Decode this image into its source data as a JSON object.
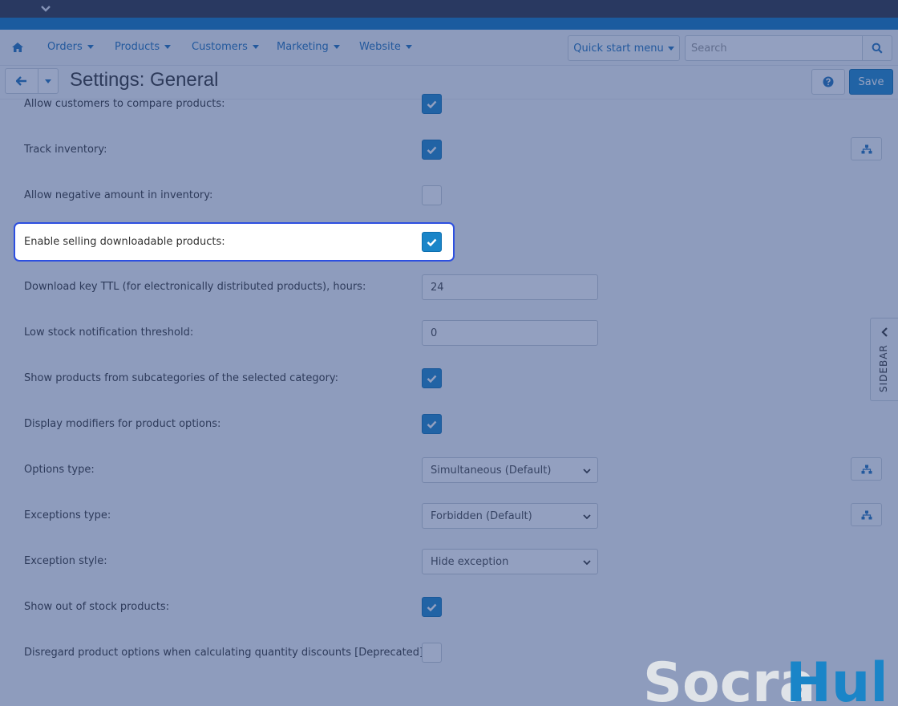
{
  "nav": {
    "items": [
      {
        "label": "Orders"
      },
      {
        "label": "Products"
      },
      {
        "label": "Customers"
      },
      {
        "label": "Marketing"
      },
      {
        "label": "Website"
      }
    ],
    "quick_start": "Quick start menu",
    "search_placeholder": "Search"
  },
  "header": {
    "title": "Settings: General",
    "save_label": "Save"
  },
  "settings": [
    {
      "label": "Allow customers to compare products:",
      "control": "checkbox",
      "checked": true
    },
    {
      "label": "Track inventory:",
      "control": "checkbox",
      "checked": true
    },
    {
      "label": "Allow negative amount in inventory:",
      "control": "checkbox",
      "checked": false
    },
    {
      "label": "Enable selling downloadable products:",
      "control": "checkbox",
      "checked": true,
      "highlighted": true
    },
    {
      "label": "Download key TTL (for electronically distributed products), hours:",
      "control": "text",
      "value": "24"
    },
    {
      "label": "Low stock notification threshold:",
      "control": "text",
      "value": "0"
    },
    {
      "label": "Show products from subcategories of the selected category:",
      "control": "checkbox",
      "checked": true
    },
    {
      "label": "Display modifiers for product options:",
      "control": "checkbox",
      "checked": true
    },
    {
      "label": "Options type:",
      "control": "select",
      "value": "Simultaneous (Default)"
    },
    {
      "label": "Exceptions type:",
      "control": "select",
      "value": "Forbidden (Default)"
    },
    {
      "label": "Exception style:",
      "control": "select",
      "value": "Hide exception"
    },
    {
      "label": "Show out of stock products:",
      "control": "checkbox",
      "checked": true
    },
    {
      "label": "Disregard product options when calculating quantity discounts [Deprecated]:",
      "control": "checkbox",
      "checked": false
    }
  ],
  "sidebar": {
    "label": "SIDEBAR"
  },
  "watermark": {
    "text_a": "Socra",
    "text_b": "Hub"
  },
  "colors": {
    "accent": "#1a85c8",
    "overlay": "#284282",
    "highlight": "#2d4fe0",
    "watermark_a": "#dfe3e8",
    "watermark_b": "#1a85c8"
  }
}
